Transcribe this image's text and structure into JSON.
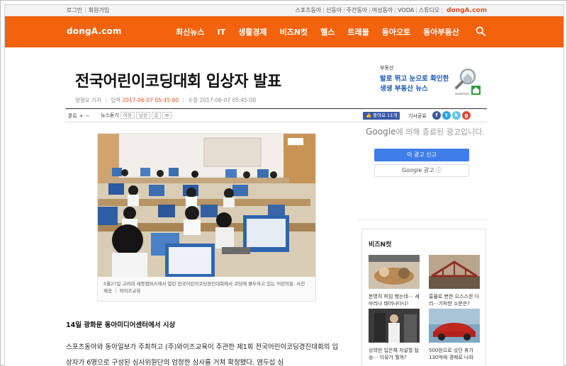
{
  "util": {
    "left_links": [
      "로그인",
      "회원가입"
    ],
    "right_links": [
      "스포츠동아",
      "신동아",
      "주간동아",
      "여성동아",
      "VODA",
      "스튜디오"
    ],
    "brand": "dongA.com"
  },
  "nav": {
    "logo": "dongA.com",
    "menu": [
      "최신뉴스",
      "IT",
      "생활경제",
      "비즈N컷",
      "헬스",
      "트래블",
      "동아오토",
      "동아부동산"
    ]
  },
  "article": {
    "title": "전국어린이코딩대회 입상자 발표",
    "author": "양형모 기자",
    "input_label": "입력",
    "input_time": "2017-06-07 05:45:00",
    "modified_label": "수정",
    "modified_time": "2017-06-07 05:45:00",
    "caption": "5월27일 고려대 세종캠퍼스에서 열린 전국어린이코딩경진대회에서 코딩에 몰두하고 있는 어린이들. 사진제공 ｜ 와이즈교육",
    "subhead": "14일 광화문 동아미디어센터에서 시상",
    "paragraph": "스포츠동아와 동아일보가 주최하고 (주)와이즈교육이 주관한 제1회 전국어린이코딩경진대회의 입상자가 6명으로 구성된 심사위원단의 엄정한 심사를 거쳐 확정됐다. 염두섭 심"
  },
  "toolbar": {
    "font_label": "폰트",
    "font_plus": "+",
    "font_minus": "−",
    "listen_label": "뉴스듣기",
    "voice_female": "여성",
    "voice_male": "남성",
    "like_label": "좋아요 11개",
    "share_label": "기사공유"
  },
  "banner": {
    "tag": "부동산",
    "line1": "발로 뛰고 눈으로 확인한",
    "line2": "생생 부동산 뉴스"
  },
  "google_ad": {
    "message_brand": "Google",
    "message_rest": "에 의해 종료된 광고입니다.",
    "report_button": "이 광고 신고",
    "ads_button": "Google 광고 ⓘ"
  },
  "bizn": {
    "title": "비즈N컷",
    "items": [
      {
        "caption": "분명히 피임 했는데⋯ 세 마리나 태어나다니!"
      },
      {
        "caption": "흉물로 변한 으스스한 다리⋯기피한 소문은?"
      },
      {
        "caption": "상의만 입은채 자살할 탑승⋯ 이유가 뭘까?"
      },
      {
        "caption": "500원으로 샀던 휴가 130억에 경매로 나와"
      }
    ]
  },
  "colors": {
    "brand_orange": "#f3620d",
    "headline_blue": "#1a56b6",
    "google_blue": "#3f7ee8",
    "facebook_blue": "#3b5ba8"
  }
}
